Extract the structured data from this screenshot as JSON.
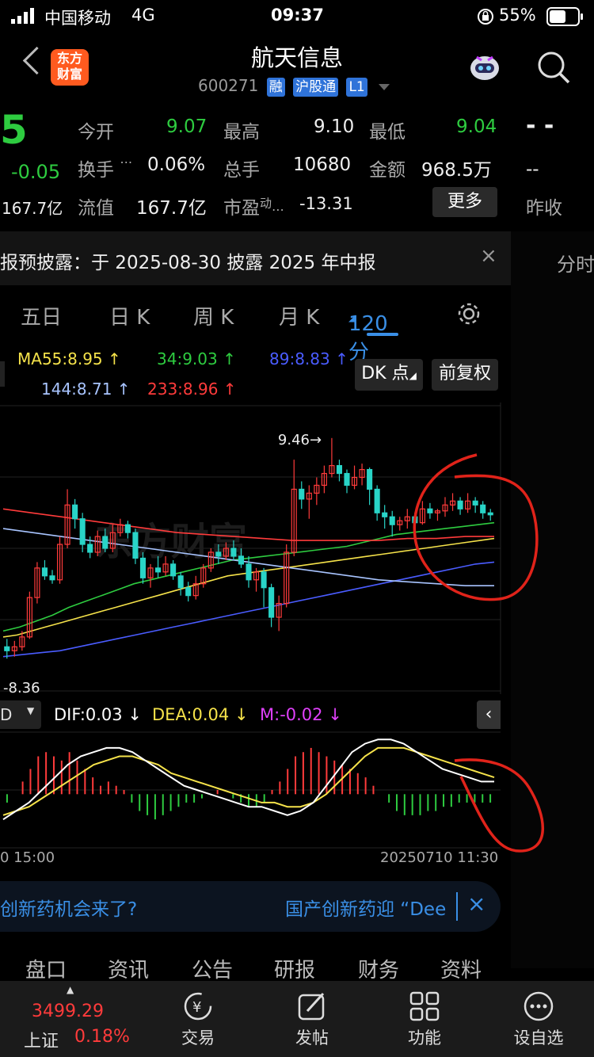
{
  "status": {
    "carrier": "中国移动",
    "network": "4G",
    "time": "09:37",
    "battery": "55%"
  },
  "header": {
    "logo_line1": "东方",
    "logo_line2": "财富",
    "title": "航天信息",
    "code": "600271",
    "badges": [
      "融",
      "沪股通",
      "L1"
    ]
  },
  "quote": {
    "price_fragment": "5",
    "change": "-0.05",
    "mktcap_fragment": "167.7亿",
    "open_label": "今开",
    "open": "9.07",
    "high_label": "最高",
    "high": "9.10",
    "low_label": "最低",
    "low": "9.04",
    "turnover_label": "换手",
    "turnover": "0.06%",
    "volume_label": "总手",
    "volume": "10680",
    "amount_label": "金额",
    "amount": "968.5万",
    "float_label": "流值",
    "float": "167.7亿",
    "pe_label": "市盈",
    "pe_sup": "动",
    "pe": "-13.31",
    "more_label": "更多",
    "right_dash1": "- -",
    "right_dash2": "--",
    "prev_close_label": "昨收"
  },
  "notice": {
    "text": "报预披露：于 2025-08-30 披露 2025 年中报",
    "side_tab": "分时"
  },
  "tabs": {
    "five_day": "五日",
    "day": "日 K",
    "week": "周 K",
    "month": "月 K",
    "min120": "120 分"
  },
  "ma": {
    "ma55": "MA55:8.95 ↑",
    "ma34": "34:9.03 ↑",
    "ma89": "89:8.83 ↑",
    "ma144": "144:8.71 ↑",
    "ma233": "233:8.96 ↑",
    "dk_button": "DK 点",
    "adjust_button": "前复权",
    "colors": {
      "ma55": "#f5e24a",
      "ma34": "#2ecc40",
      "ma89": "#4a5cff",
      "ma144": "#a8c4ff",
      "ma233": "#ff3b3b"
    }
  },
  "chart_labels": {
    "high_mark": "9.46",
    "low_mark": "8.36",
    "watermark": "东方财富"
  },
  "macd": {
    "selector": "D",
    "dif": "DIF:0.03 ↓",
    "dea": "DEA:0.04 ↓",
    "m": "M:-0.02 ↓",
    "time_left": "0 15:00",
    "time_right": "20250710 11:30"
  },
  "marquee": {
    "left": "创新药机会来了?",
    "right": "国产创新药迎 “Dee"
  },
  "bottom_tabs": [
    "盘口",
    "资讯",
    "公告",
    "研报",
    "财务",
    "资料"
  ],
  "nav": {
    "index_value": "3499.29",
    "index_name": "上证",
    "index_change": "0.18%",
    "trade": "交易",
    "post": "发帖",
    "func": "功能",
    "custom": "设自选"
  },
  "chart_data": {
    "type": "candlestick",
    "title": "",
    "xlabel": "",
    "ylabel": "",
    "ylim": [
      8.2,
      9.6
    ],
    "annotations": [
      {
        "label": "9.46",
        "value": 9.46
      },
      {
        "label": "8.36",
        "value": 8.36
      }
    ],
    "candles": [
      [
        8.4,
        8.38,
        8.44,
        8.34
      ],
      [
        8.38,
        8.4,
        8.43,
        8.35
      ],
      [
        8.4,
        8.45,
        8.48,
        8.38
      ],
      [
        8.45,
        8.65,
        8.68,
        8.44
      ],
      [
        8.65,
        8.8,
        8.83,
        8.62
      ],
      [
        8.8,
        8.76,
        8.84,
        8.74
      ],
      [
        8.76,
        8.74,
        8.79,
        8.72
      ],
      [
        8.74,
        8.92,
        8.96,
        8.72
      ],
      [
        8.92,
        9.12,
        9.2,
        8.9
      ],
      [
        9.12,
        9.05,
        9.15,
        9.0
      ],
      [
        9.05,
        8.92,
        9.08,
        8.88
      ],
      [
        8.92,
        8.88,
        8.96,
        8.85
      ],
      [
        8.88,
        8.96,
        8.99,
        8.86
      ],
      [
        8.96,
        8.9,
        9.0,
        8.88
      ],
      [
        8.9,
        8.98,
        9.02,
        8.88
      ],
      [
        8.98,
        9.02,
        9.05,
        8.96
      ],
      [
        9.02,
        8.98,
        9.04,
        8.95
      ],
      [
        8.98,
        8.85,
        9.0,
        8.82
      ],
      [
        8.85,
        8.75,
        8.88,
        8.72
      ],
      [
        8.75,
        8.8,
        8.82,
        8.7
      ],
      [
        8.8,
        8.78,
        8.86,
        8.75
      ],
      [
        8.78,
        8.82,
        8.86,
        8.76
      ],
      [
        8.82,
        8.76,
        8.84,
        8.74
      ],
      [
        8.76,
        8.7,
        8.78,
        8.66
      ],
      [
        8.7,
        8.66,
        8.73,
        8.63
      ],
      [
        8.66,
        8.72,
        8.76,
        8.64
      ],
      [
        8.72,
        8.8,
        8.82,
        8.7
      ],
      [
        8.8,
        8.88,
        8.9,
        8.78
      ],
      [
        8.88,
        8.86,
        8.92,
        8.82
      ],
      [
        8.86,
        8.9,
        8.93,
        8.84
      ],
      [
        8.9,
        8.86,
        8.94,
        8.84
      ],
      [
        8.86,
        8.82,
        8.9,
        8.8
      ],
      [
        8.82,
        8.74,
        8.86,
        8.7
      ],
      [
        8.74,
        8.78,
        8.8,
        8.68
      ],
      [
        8.78,
        8.7,
        8.8,
        8.6
      ],
      [
        8.7,
        8.55,
        8.72,
        8.5
      ],
      [
        8.55,
        8.62,
        8.66,
        8.48
      ],
      [
        8.62,
        8.88,
        8.92,
        8.6
      ],
      [
        8.88,
        9.2,
        9.35,
        8.86
      ],
      [
        9.2,
        9.15,
        9.24,
        9.1
      ],
      [
        9.15,
        9.18,
        9.22,
        9.05
      ],
      [
        9.18,
        9.22,
        9.26,
        9.12
      ],
      [
        9.22,
        9.28,
        9.32,
        9.18
      ],
      [
        9.28,
        9.32,
        9.46,
        9.26
      ],
      [
        9.32,
        9.28,
        9.35,
        9.24
      ],
      [
        9.28,
        9.22,
        9.3,
        9.18
      ],
      [
        9.22,
        9.26,
        9.32,
        9.2
      ],
      [
        9.26,
        9.3,
        9.33,
        9.22
      ],
      [
        9.3,
        9.2,
        9.31,
        9.12
      ],
      [
        9.2,
        9.08,
        9.22,
        9.04
      ],
      [
        9.08,
        9.06,
        9.12,
        9.0
      ],
      [
        9.06,
        9.02,
        9.09,
        8.96
      ],
      [
        9.02,
        9.04,
        9.06,
        8.99
      ],
      [
        9.04,
        9.06,
        9.1,
        9.0
      ],
      [
        9.06,
        9.03,
        9.08,
        9.0
      ],
      [
        9.03,
        9.1,
        9.14,
        9.02
      ],
      [
        9.1,
        9.08,
        9.13,
        9.05
      ],
      [
        9.08,
        9.09,
        9.1,
        9.04
      ],
      [
        9.09,
        9.12,
        9.16,
        9.06
      ],
      [
        9.12,
        9.14,
        9.18,
        9.09
      ],
      [
        9.14,
        9.1,
        9.16,
        9.07
      ],
      [
        9.1,
        9.14,
        9.18,
        9.08
      ],
      [
        9.14,
        9.12,
        9.16,
        9.08
      ],
      [
        9.12,
        9.08,
        9.14,
        9.05
      ],
      [
        9.08,
        9.07,
        9.1,
        9.04
      ]
    ],
    "series": [
      {
        "name": "MA55",
        "values": [
          8.45,
          8.46,
          8.48,
          8.5,
          8.52,
          8.54,
          8.56,
          8.58,
          8.6,
          8.62,
          8.64,
          8.66,
          8.68,
          8.7,
          8.72,
          8.74,
          8.76,
          8.77,
          8.78,
          8.79,
          8.8,
          8.81,
          8.82,
          8.83,
          8.84,
          8.85,
          8.86,
          8.87,
          8.88,
          8.89,
          8.9,
          8.91,
          8.92,
          8.93,
          8.94,
          8.95
        ]
      },
      {
        "name": "34",
        "values": [
          8.48,
          8.5,
          8.53,
          8.56,
          8.6,
          8.63,
          8.66,
          8.69,
          8.72,
          8.74,
          8.76,
          8.78,
          8.8,
          8.82,
          8.84,
          8.85,
          8.86,
          8.87,
          8.88,
          8.89,
          8.9,
          8.91,
          8.93,
          8.95,
          8.97,
          8.98,
          8.99,
          9.0,
          9.01,
          9.02,
          9.03
        ]
      },
      {
        "name": "89",
        "values": [
          8.35,
          8.36,
          8.37,
          8.38,
          8.4,
          8.42,
          8.44,
          8.46,
          8.48,
          8.5,
          8.52,
          8.54,
          8.56,
          8.58,
          8.6,
          8.62,
          8.64,
          8.66,
          8.68,
          8.7,
          8.72,
          8.74,
          8.76,
          8.78,
          8.8,
          8.82,
          8.83
        ]
      },
      {
        "name": "144",
        "values": [
          9.0,
          8.98,
          8.96,
          8.94,
          8.92,
          8.9,
          8.88,
          8.86,
          8.84,
          8.82,
          8.8,
          8.78,
          8.76,
          8.74,
          8.73,
          8.72,
          8.71,
          8.71
        ]
      },
      {
        "name": "233",
        "values": [
          9.1,
          9.08,
          9.06,
          9.04,
          9.02,
          9.0,
          8.98,
          8.97,
          8.96,
          8.95,
          8.94,
          8.94,
          8.94,
          8.94,
          8.95,
          8.95,
          8.96,
          8.96
        ]
      }
    ],
    "macd": {
      "ylim": [
        -0.12,
        0.14
      ],
      "hist": [
        -0.02,
        0.0,
        0.03,
        0.06,
        0.09,
        0.1,
        0.09,
        0.08,
        0.1,
        0.08,
        0.06,
        0.04,
        0.02,
        0.03,
        0.02,
        0.01,
        -0.02,
        -0.04,
        -0.05,
        -0.06,
        -0.05,
        -0.04,
        -0.03,
        -0.02,
        -0.02,
        -0.01,
        0.0,
        0.01,
        0.0,
        -0.01,
        -0.02,
        -0.03,
        -0.03,
        -0.02,
        0.01,
        0.03,
        0.06,
        0.09,
        0.1,
        0.11,
        0.1,
        0.09,
        0.08,
        0.07,
        0.06,
        0.05,
        0.04,
        0.02,
        0.0,
        -0.02,
        -0.04,
        -0.05,
        -0.05,
        -0.05,
        -0.04,
        -0.04,
        -0.03,
        -0.03,
        -0.02,
        -0.02,
        -0.02,
        -0.02,
        -0.02
      ],
      "dif": [
        -0.06,
        -0.04,
        -0.02,
        0.01,
        0.04,
        0.07,
        0.09,
        0.1,
        0.11,
        0.11,
        0.1,
        0.08,
        0.06,
        0.04,
        0.02,
        0.01,
        0.0,
        -0.01,
        -0.02,
        -0.03,
        -0.03,
        -0.04,
        -0.05,
        -0.04,
        -0.02,
        0.02,
        0.06,
        0.1,
        0.12,
        0.13,
        0.13,
        0.12,
        0.1,
        0.08,
        0.06,
        0.05,
        0.04,
        0.03,
        0.03
      ],
      "dea": [
        -0.05,
        -0.04,
        -0.03,
        -0.01,
        0.01,
        0.03,
        0.05,
        0.07,
        0.08,
        0.09,
        0.09,
        0.08,
        0.07,
        0.05,
        0.04,
        0.03,
        0.02,
        0.01,
        0.0,
        -0.01,
        -0.02,
        -0.02,
        -0.03,
        -0.03,
        -0.02,
        0.0,
        0.03,
        0.06,
        0.09,
        0.11,
        0.11,
        0.11,
        0.1,
        0.09,
        0.08,
        0.07,
        0.06,
        0.05,
        0.04
      ]
    }
  }
}
